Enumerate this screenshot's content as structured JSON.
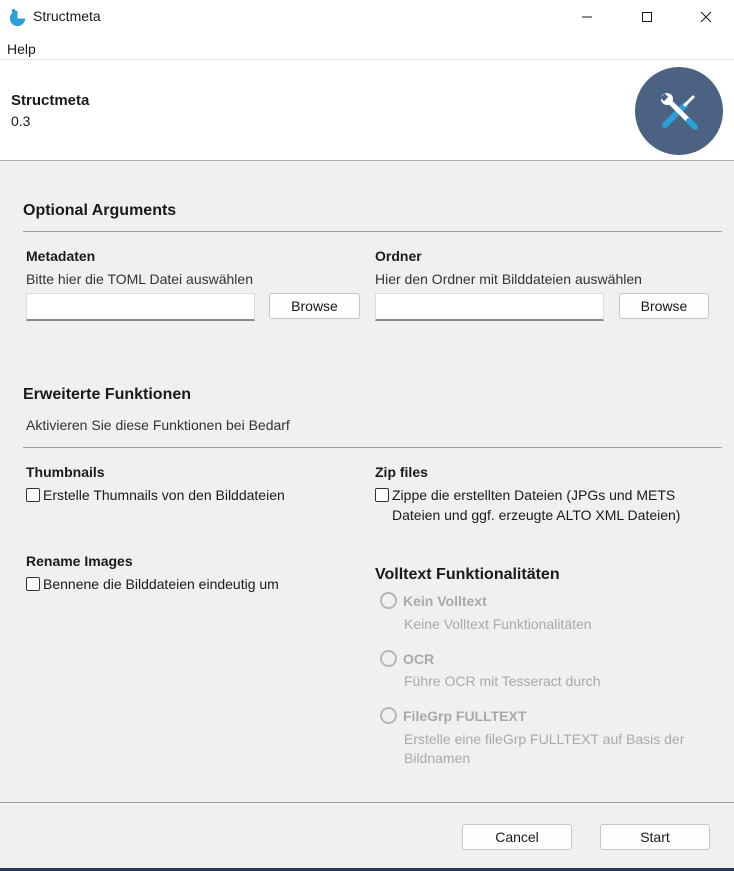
{
  "window": {
    "title": "Structmeta",
    "minimize_glyph": "—",
    "maximize_glyph": "□",
    "close_glyph": "✕"
  },
  "menu": {
    "help": "Help"
  },
  "header": {
    "name": "Structmeta",
    "version": "0.3",
    "logo_icon": "wrench-screwdriver-icon"
  },
  "optional": {
    "title": "Optional Arguments",
    "metadaten": {
      "label": "Metadaten",
      "help": "Bitte hier die TOML Datei auswählen",
      "value": "",
      "browse": "Browse"
    },
    "ordner": {
      "label": "Ordner",
      "help": "Hier den Ordner mit Bilddateien auswählen",
      "value": "",
      "browse": "Browse"
    }
  },
  "extended": {
    "title": "Erweiterte Funktionen",
    "subtitle": "Aktivieren Sie diese Funktionen bei Bedarf",
    "thumbnails": {
      "label": "Thumbnails",
      "checkbox": "Erstelle Thumnails von den Bilddateien",
      "checked": false
    },
    "zip": {
      "label": "Zip files",
      "checkbox_line1": "Zippe die erstellten Dateien (JPGs und METS",
      "checkbox_line2": "Dateien und ggf. erzeugte ALTO XML Dateien)",
      "checked": false
    },
    "rename": {
      "label": "Rename Images",
      "checkbox": "Bennene die Bilddateien eindeutig um",
      "checked": false
    },
    "volltext": {
      "title": "Volltext Funktionalitäten",
      "options": [
        {
          "label": "Kein Volltext",
          "help": "Keine Volltext Funktionalitäten"
        },
        {
          "label": "OCR",
          "help": "Führe OCR mit Tesseract durch"
        },
        {
          "label": "FileGrp FULLTEXT",
          "help_line1": "Erstelle eine fileGrp FULLTEXT auf Basis der",
          "help_line2": "Bildnamen"
        }
      ]
    }
  },
  "footer": {
    "cancel": "Cancel",
    "start": "Start"
  },
  "colors": {
    "logo_bg": "#4b6282",
    "accent": "#2a9fd8",
    "disabled_text": "#a9a9a9"
  }
}
